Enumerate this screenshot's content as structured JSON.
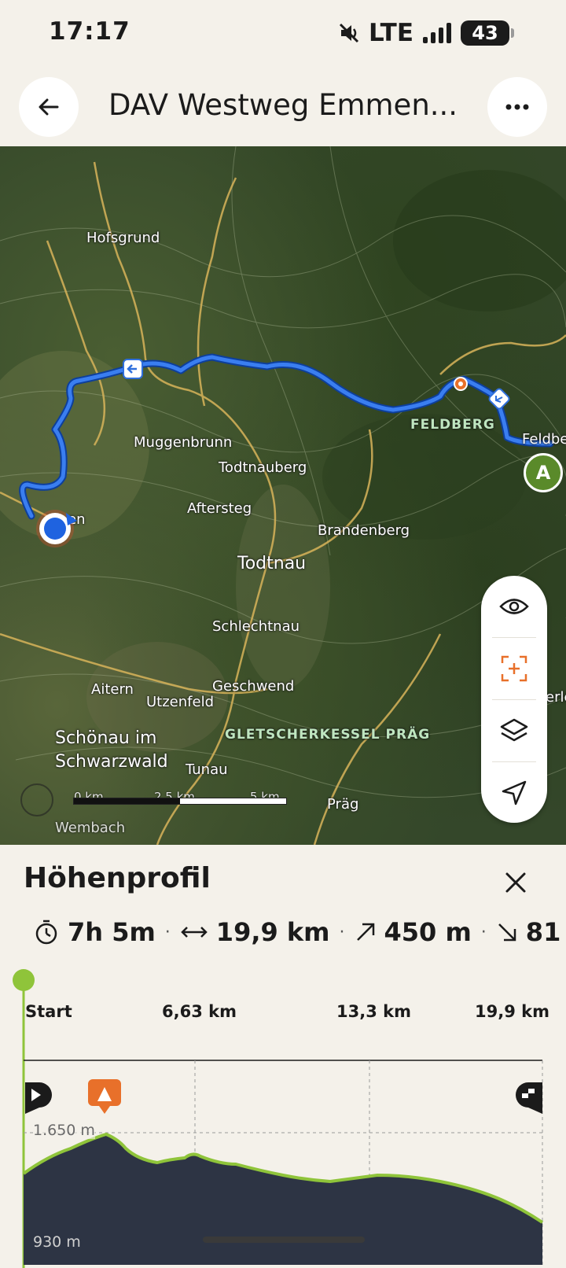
{
  "status_bar": {
    "time": "17:17",
    "network": "LTE",
    "battery": "43",
    "icons": [
      "mute-icon",
      "signal-icon",
      "battery-icon"
    ]
  },
  "header": {
    "title": "DAV Westweg Emmen...",
    "back_icon": "back-arrow-icon",
    "more_icon": "more-dots-icon"
  },
  "map": {
    "places": {
      "hofsgrund": "Hofsgrund",
      "muggenbrunn": "Muggenbrunn",
      "todtnauberg": "Todtnauberg",
      "aftersteg": "Aftersteg",
      "brandenberg": "Brandenberg",
      "todtnau": "Todtnau",
      "schlechtnau": "Schlechtnau",
      "aitern": "Aitern",
      "geschwend": "Geschwend",
      "utzenfeld": "Utzenfeld",
      "schoenau": "Schönau im\nSchwarzwald",
      "tunau": "Tunau",
      "praeg": "Präg",
      "feldberg_region": "FELDBERG",
      "gletscherkessel": "GLETSCHERKESSEL PRÄG",
      "feldberg_edge": "Feldbe",
      "edge_fragment": "en",
      "right_edge": "erle",
      "bottom_fragment": "Wembach"
    },
    "end_marker": "A",
    "scale": [
      "0 km",
      "2,5 km",
      "5 km"
    ],
    "controls": [
      "eye-icon",
      "focus-add-icon",
      "layers-icon",
      "navigate-icon"
    ],
    "route_color": "#2f6fdc"
  },
  "sheet": {
    "title": "Höhenprofil",
    "stats": {
      "duration": "7h 5m",
      "distance": "19,9 km",
      "ascent": "450 m",
      "descent": "81"
    },
    "km_labels": [
      "Start",
      "6,63 km",
      "13,3 km",
      "19,9 km"
    ],
    "elevation_max_label": "1.650 m",
    "elevation_min_label": "930 m",
    "profile_colors": {
      "fill": "#2d3444",
      "line": "#8fc43a",
      "start": "#8fc43a",
      "summit": "#e8702a"
    }
  }
}
